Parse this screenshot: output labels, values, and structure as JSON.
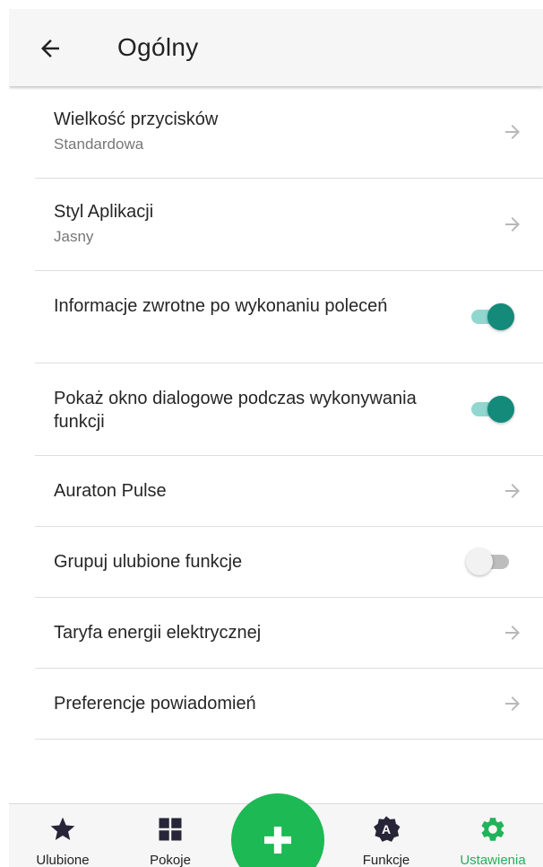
{
  "header": {
    "title": "Ogólny"
  },
  "settings": [
    {
      "title": "Wielkość przycisków",
      "subtitle": "Standardowa"
    },
    {
      "title": "Styl Aplikacji",
      "subtitle": "Jasny"
    },
    {
      "title": "Informacje zwrotne po wykonaniu poleceń",
      "toggle": true
    },
    {
      "title": "Pokaż okno dialogowe podczas wykonywania funkcji",
      "toggle": true
    },
    {
      "title": "Auraton Pulse"
    },
    {
      "title": "Grupuj ulubione funkcje",
      "toggle": false
    },
    {
      "title": "Taryfa energii elektrycznej"
    },
    {
      "title": "Preferencje powiadomień"
    }
  ],
  "nav": {
    "items": [
      {
        "label": "Ulubione",
        "icon": "star-icon"
      },
      {
        "label": "Pokoje",
        "icon": "grid-icon"
      },
      {
        "label": "Funkcje",
        "icon": "function-badge-icon",
        "badge": "A"
      },
      {
        "label": "Ustawienia",
        "icon": "gear-icon",
        "active": true
      }
    ],
    "fab_icon": "plus-icon"
  },
  "colors": {
    "accent_green": "#1db954",
    "active_label": "#1fb35a",
    "toggle_on_thumb": "#138a7a",
    "toggle_on_track": "#92d7cf",
    "chevron": "#b8b8b8",
    "header_bg": "#f6f6f6"
  }
}
